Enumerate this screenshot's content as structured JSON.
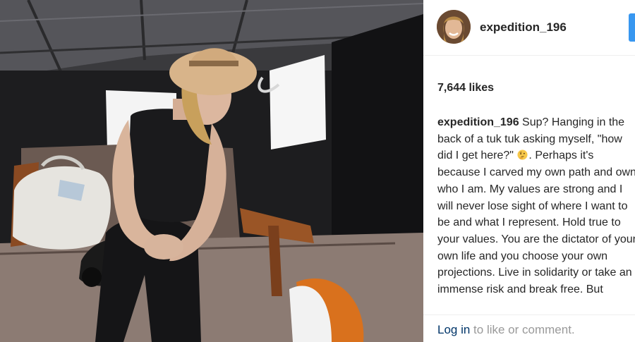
{
  "post": {
    "photo_description_icon": "post-photo",
    "author": {
      "username": "expedition_196",
      "avatar_icon": "profile-photo"
    },
    "follow_button": {
      "color": "#3897f0"
    },
    "likes_text": "7,644 likes",
    "caption": {
      "username": "expedition_196",
      "text_before_emoji": " Sup? Hanging in the back of a tuk tuk asking myself, \"how did I get here?\" ",
      "emoji_icon": "thinking-face-emoji",
      "text_after_emoji": ". Perhaps it's because I carved my own path and own who I am. My values are strong and I will never lose sight of where I want to be and what I represent. Hold true to your values. You are the dictator of your own life and you choose your own projections. Live in solidarity or take an immense risk and break free. But whatever you do, never stop learning, never stop educating"
    },
    "login_prompt": {
      "link_text": "Log in",
      "rest_text": " to like or comment."
    }
  },
  "colors": {
    "text": "#262626",
    "muted": "#999999",
    "link": "#003569",
    "accent": "#3897f0"
  }
}
